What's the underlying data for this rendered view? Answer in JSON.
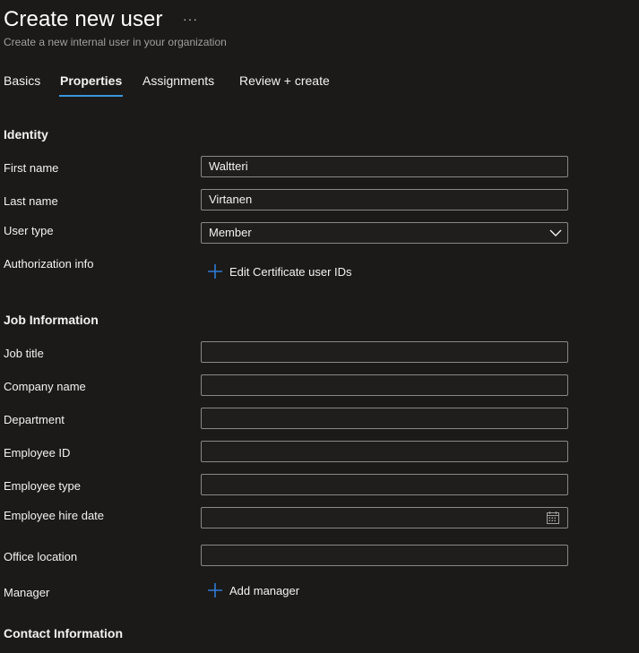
{
  "header": {
    "title": "Create new user",
    "more_label": "···",
    "subtitle": "Create a new internal user in your organization"
  },
  "tabs": [
    {
      "label": "Basics",
      "active": false
    },
    {
      "label": "Properties",
      "active": true
    },
    {
      "label": "Assignments",
      "active": false
    },
    {
      "label": "Review + create",
      "active": false
    }
  ],
  "identity": {
    "section_title": "Identity",
    "first_name": {
      "label": "First name",
      "value": "Waltteri"
    },
    "last_name": {
      "label": "Last name",
      "value": "Virtanen"
    },
    "user_type": {
      "label": "User type",
      "value": "Member"
    },
    "authorization": {
      "label": "Authorization info",
      "link": "Edit Certificate user IDs"
    }
  },
  "job": {
    "section_title": "Job Information",
    "job_title": {
      "label": "Job title",
      "value": ""
    },
    "company_name": {
      "label": "Company name",
      "value": ""
    },
    "department": {
      "label": "Department",
      "value": ""
    },
    "employee_id": {
      "label": "Employee ID",
      "value": ""
    },
    "employee_type": {
      "label": "Employee type",
      "value": ""
    },
    "hire_date": {
      "label": "Employee hire date",
      "value": ""
    },
    "office_location": {
      "label": "Office location",
      "value": ""
    },
    "manager": {
      "label": "Manager",
      "link": "Add manager"
    }
  },
  "contact": {
    "section_title": "Contact Information"
  },
  "colors": {
    "background": "#1b1a19",
    "accent": "#3a96dd",
    "plus_icon": "#2f7bd4",
    "border": "#8a8886"
  }
}
